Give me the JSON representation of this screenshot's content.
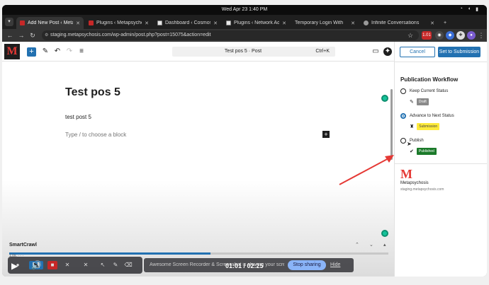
{
  "os": {
    "clock": "Wed Apr 23   1:40 PM",
    "status_icons": [
      "wifi-icon",
      "volume-icon",
      "battery-icon"
    ]
  },
  "browser": {
    "tabs": [
      {
        "title": "Add New Post ‹ Meta",
        "favicon": "metapsychosis-icon"
      },
      {
        "title": "Plugins ‹ Metapsycho",
        "favicon": "metapsychosis-icon"
      },
      {
        "title": "Dashboard ‹ Cosmos",
        "favicon": "dashboard-icon"
      },
      {
        "title": "Plugins ‹ Network Ad",
        "favicon": "dashboard-icon"
      },
      {
        "title": "Temporary Login With",
        "favicon": "wordpress-icon"
      },
      {
        "title": "Infinite Conversations",
        "favicon": "circle-icon"
      }
    ],
    "url": "staging.metapsychosis.com/wp-admin/post.php?post=15075&action=edit",
    "extension_badge": "1.01"
  },
  "editor": {
    "logo_letter": "M",
    "command_bar_title": "Test pos 5 · Post",
    "command_bar_shortcut": "Ctrl+K",
    "post_title": "Test pos 5",
    "post_paragraph": "test post 5",
    "block_placeholder": "Type / to choose a block",
    "smartcrawl_label": "SmartCrawl",
    "mini_panel_text": "1.0s.   ·   ·   ·",
    "progress_fraction": 0.53
  },
  "sidebar": {
    "cancel_label": "Cancel",
    "submit_label": "Set to Submission",
    "workflow_heading": "Publication Workflow",
    "options": [
      {
        "label": "Keep Current Status",
        "badge": "Draft",
        "checked": false
      },
      {
        "label": "Advance to Next Status",
        "badge": "Submission",
        "checked": true
      },
      {
        "label": "Publish",
        "badge": "Published",
        "checked": false
      }
    ],
    "site_logo_letter": "M",
    "site_name": "Metapsychosis",
    "site_url": "staging.metapsychosis.com"
  },
  "recorder": {
    "share_text": "Awesome Screen Recorder & Screenshot is sharing your screen.",
    "stop_label": "Stop sharing",
    "hide_label": "Hide"
  },
  "player": {
    "time": "01:01 / 02:25",
    "speed": "1x"
  },
  "colors": {
    "wp_blue": "#2271b1",
    "brand_red": "#e53935",
    "annotation_arrow": "#e53935",
    "published_green": "#1b7a2a",
    "submission_yellow": "#ffeb3b"
  }
}
